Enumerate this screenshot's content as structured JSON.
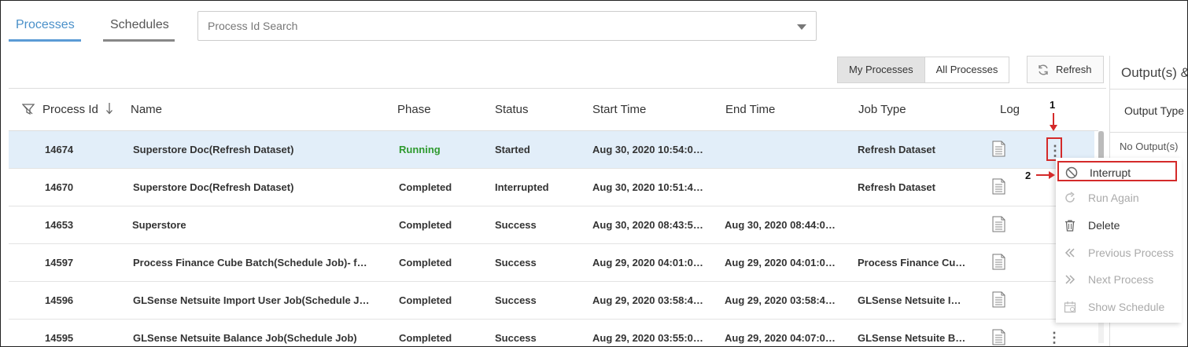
{
  "tabs": [
    {
      "label": "Processes",
      "active": true
    },
    {
      "label": "Schedules",
      "active": false
    }
  ],
  "search": {
    "placeholder": "Process Id Search"
  },
  "toolbar": {
    "my_processes": "My Processes",
    "all_processes": "All Processes",
    "refresh": "Refresh"
  },
  "table": {
    "headers": {
      "process_id": "Process Id",
      "name": "Name",
      "phase": "Phase",
      "status": "Status",
      "start_time": "Start Time",
      "end_time": "End Time",
      "job_type": "Job Type",
      "log": "Log"
    },
    "rows": [
      {
        "id": "14674",
        "name": "Superstore Doc(Refresh Dataset)",
        "phase": "Running",
        "status": "Started",
        "start": "Aug 30, 2020 10:54:0…",
        "end": "",
        "job_type": "Refresh Dataset"
      },
      {
        "id": "14670",
        "name": "Superstore Doc(Refresh Dataset)",
        "phase": "Completed",
        "status": "Interrupted",
        "start": "Aug 30, 2020 10:51:4…",
        "end": "",
        "job_type": "Refresh Dataset"
      },
      {
        "id": "14653",
        "name": "Superstore",
        "phase": "Completed",
        "status": "Success",
        "start": "Aug 30, 2020 08:43:5…",
        "end": "Aug 30, 2020 08:44:0…",
        "job_type": ""
      },
      {
        "id": "14597",
        "name": "Process Finance Cube Batch(Schedule Job)- f…",
        "phase": "Completed",
        "status": "Success",
        "start": "Aug 29, 2020 04:01:0…",
        "end": "Aug 29, 2020 04:01:0…",
        "job_type": "Process Finance Cu…"
      },
      {
        "id": "14596",
        "name": "GLSense Netsuite Import User Job(Schedule J…",
        "phase": "Completed",
        "status": "Success",
        "start": "Aug 29, 2020 03:58:4…",
        "end": "Aug 29, 2020 03:58:4…",
        "job_type": "GLSense Netsuite I…"
      },
      {
        "id": "14595",
        "name": "GLSense Netsuite Balance Job(Schedule Job)",
        "phase": "Completed",
        "status": "Success",
        "start": "Aug 29, 2020 03:55:0…",
        "end": "Aug 29, 2020 04:07:0…",
        "job_type": "GLSense Netsuite B…"
      }
    ]
  },
  "context_menu": {
    "items": [
      {
        "label": "Interrupt",
        "icon": "block-icon",
        "enabled": true
      },
      {
        "label": "Run Again",
        "icon": "redo-icon",
        "enabled": false
      },
      {
        "label": "Delete",
        "icon": "trash-icon",
        "enabled": true
      },
      {
        "label": "Previous Process",
        "icon": "double-chevron-left-icon",
        "enabled": false
      },
      {
        "label": "Next Process",
        "icon": "double-chevron-right-icon",
        "enabled": false
      },
      {
        "label": "Show Schedule",
        "icon": "calendar-icon",
        "enabled": false
      }
    ]
  },
  "right_panel": {
    "title": "Output(s) &",
    "column": "Output Type",
    "empty": "No Output(s)"
  },
  "annotations": {
    "step1": "1",
    "step2": "2"
  },
  "colors": {
    "accent": "#5b9bd5",
    "running": "#2e9a2e",
    "highlight": "#d42a2a",
    "selected_row": "#e2eef9"
  }
}
